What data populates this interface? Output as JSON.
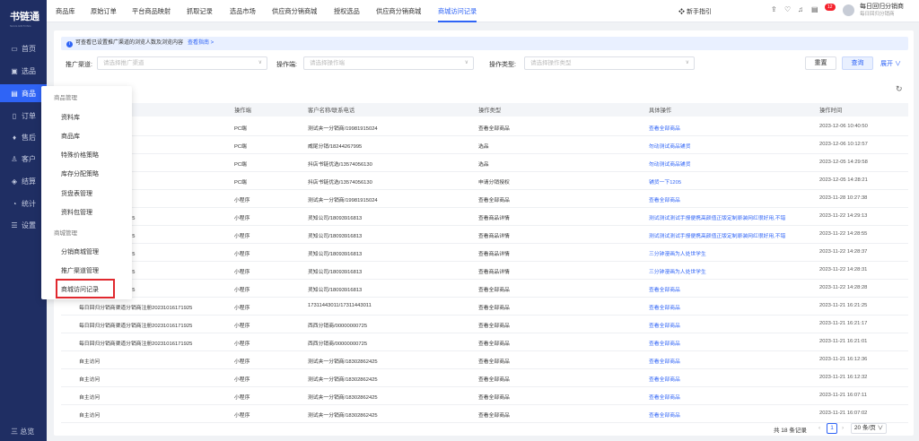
{
  "app": {
    "name": "书链通",
    "subtitle": "SHULIANTONG"
  },
  "sidebar": {
    "items": [
      {
        "icon": "desktop-icon",
        "label": "首页"
      },
      {
        "icon": "select-icon",
        "label": "选品"
      },
      {
        "icon": "product-icon",
        "label": "商品"
      },
      {
        "icon": "order-icon",
        "label": "订单"
      },
      {
        "icon": "aftersale-icon",
        "label": "售后"
      },
      {
        "icon": "customer-icon",
        "label": "客户"
      },
      {
        "icon": "finance-icon",
        "label": "结算"
      },
      {
        "icon": "stats-icon",
        "label": "统计"
      },
      {
        "icon": "settings-icon",
        "label": "设置"
      }
    ],
    "bottom": "三 总览"
  },
  "tabs": [
    "商品库",
    "原始订单",
    "平台商品映射",
    "抓取记录",
    "选品市场",
    "供应商分销商城",
    "授权选品",
    "供应商分销商城",
    "商城访问记录"
  ],
  "header": {
    "guide": "新手指引",
    "badge": "12",
    "user": "每日回归分销商",
    "user_sub": "每日回归分销商"
  },
  "tip": {
    "text": "可查看已设置推广渠道的浏览人数及浏览内容",
    "link": "查看指南 >"
  },
  "filters": {
    "channel_label": "推广渠道:",
    "channel_placeholder": "请选择推广渠道",
    "end_label": "操作端:",
    "end_placeholder": "请选择操作端",
    "type_label": "操作类型:",
    "type_placeholder": "请选择操作类型",
    "reset": "重置",
    "search": "查询",
    "expand": "展开 ∨"
  },
  "popup": {
    "group1": "商品管理",
    "items1": [
      "资料库",
      "商品库",
      "特殊价格策略",
      "库存分配策略",
      "货盘表管理",
      "资料包管理"
    ],
    "group2": "商城管理",
    "items2": [
      "分销商城管理",
      "推广渠道管理",
      "商城访问记录"
    ]
  },
  "table": {
    "columns": [
      "操作端",
      "客户名称/联系电话",
      "操作类型",
      "具体操作",
      "操作时间"
    ],
    "rows": [
      {
        "c0": "",
        "c1": "PC端",
        "c2": "测试夹一分销商/19981915024",
        "c3": "查看全部商品",
        "c4": "查看全部商品",
        "c5": "2023-12-06 10:40:50"
      },
      {
        "c0": "",
        "c1": "PC端",
        "c2": "威尾分销/18244267995",
        "c3": "选品",
        "c4": "勿动测试商品铺货",
        "c5": "2023-12-06 10:12:57"
      },
      {
        "c0": "",
        "c1": "PC端",
        "c2": "抖店书链优选/13574056130",
        "c3": "选品",
        "c4": "勿动测试商品铺货",
        "c5": "2023-12-05 14:29:58"
      },
      {
        "c0": "",
        "c1": "PC端",
        "c2": "抖店书链优选/13574056130",
        "c3": "申请分销授权",
        "c4": "铺货一下1205",
        "c5": "2023-12-05 14:28:21"
      },
      {
        "c0": "",
        "c1": "小程序",
        "c2": "测试夹一分销商/19981915024",
        "c3": "查看全部商品",
        "c4": "查看全部商品",
        "c5": "2023-11-28 10:27:38"
      },
      {
        "c0": "司注册20231016171925",
        "c1": "小程序",
        "c2": "灵知公司/18093916813",
        "c3": "查看商品详情",
        "c4": "测试测试测试手报便携高颜值正版定制原装网红很好用,不错",
        "c5": "2023-11-22 14:29:13"
      },
      {
        "c0": "司注册20231016171925",
        "c1": "小程序",
        "c2": "灵知公司/18093916813",
        "c3": "查看商品详情",
        "c4": "测试测试测试手报便携高颜值正版定制原装网红很好用,不错",
        "c5": "2023-11-22 14:28:55"
      },
      {
        "c0": "司注册20231016171925",
        "c1": "小程序",
        "c2": "灵知公司/18093916813",
        "c3": "查看商品详情",
        "c4": "三分钟漫画为人处世学生",
        "c5": "2023-11-22 14:28:37"
      },
      {
        "c0": "司注册20231016171925",
        "c1": "小程序",
        "c2": "灵知公司/18093916813",
        "c3": "查看商品详情",
        "c4": "三分钟漫画为人处世学生",
        "c5": "2023-11-22 14:28:31"
      },
      {
        "c0": "司注册20231016171925",
        "c1": "小程序",
        "c2": "灵知公司/18093916813",
        "c3": "查看全部商品",
        "c4": "查看全部商品",
        "c5": "2023-11-22 14:28:28"
      },
      {
        "c0": "每日回归分销商渠道分销商注册20231016171925",
        "c1": "小程序",
        "c2": "17311443011/17311443011",
        "c3": "查看全部商品",
        "c4": "查看全部商品",
        "c5": "2023-11-21 16:21:25"
      },
      {
        "c0": "每日回归分销商渠道分销商注册20231016171925",
        "c1": "小程序",
        "c2": "西西分销商/00000000725",
        "c3": "查看全部商品",
        "c4": "查看全部商品",
        "c5": "2023-11-21 16:21:17"
      },
      {
        "c0": "每日回归分销商渠道分销商注册20231016171925",
        "c1": "小程序",
        "c2": "西西分销商/00000000725",
        "c3": "查看全部商品",
        "c4": "查看全部商品",
        "c5": "2023-11-21 16:21:01"
      },
      {
        "c0": "自主访问",
        "c1": "小程序",
        "c2": "测试夹一分销商/18302862425",
        "c3": "查看全部商品",
        "c4": "查看全部商品",
        "c5": "2023-11-21 16:12:36"
      },
      {
        "c0": "自主访问",
        "c1": "小程序",
        "c2": "测试夹一分销商/18302862425",
        "c3": "查看全部商品",
        "c4": "查看全部商品",
        "c5": "2023-11-21 16:12:32"
      },
      {
        "c0": "自主访问",
        "c1": "小程序",
        "c2": "测试夹一分销商/18302862425",
        "c3": "查看全部商品",
        "c4": "查看全部商品",
        "c5": "2023-11-21 16:07:11"
      },
      {
        "c0": "自主访问",
        "c1": "小程序",
        "c2": "测试夹一分销商/18302862425",
        "c3": "查看全部商品",
        "c4": "查看全部商品",
        "c5": "2023-11-21 16:07:02"
      }
    ]
  },
  "pagination": {
    "total": "共 18 条记录",
    "current": "1",
    "per_page": "20 条/页 ∨"
  }
}
